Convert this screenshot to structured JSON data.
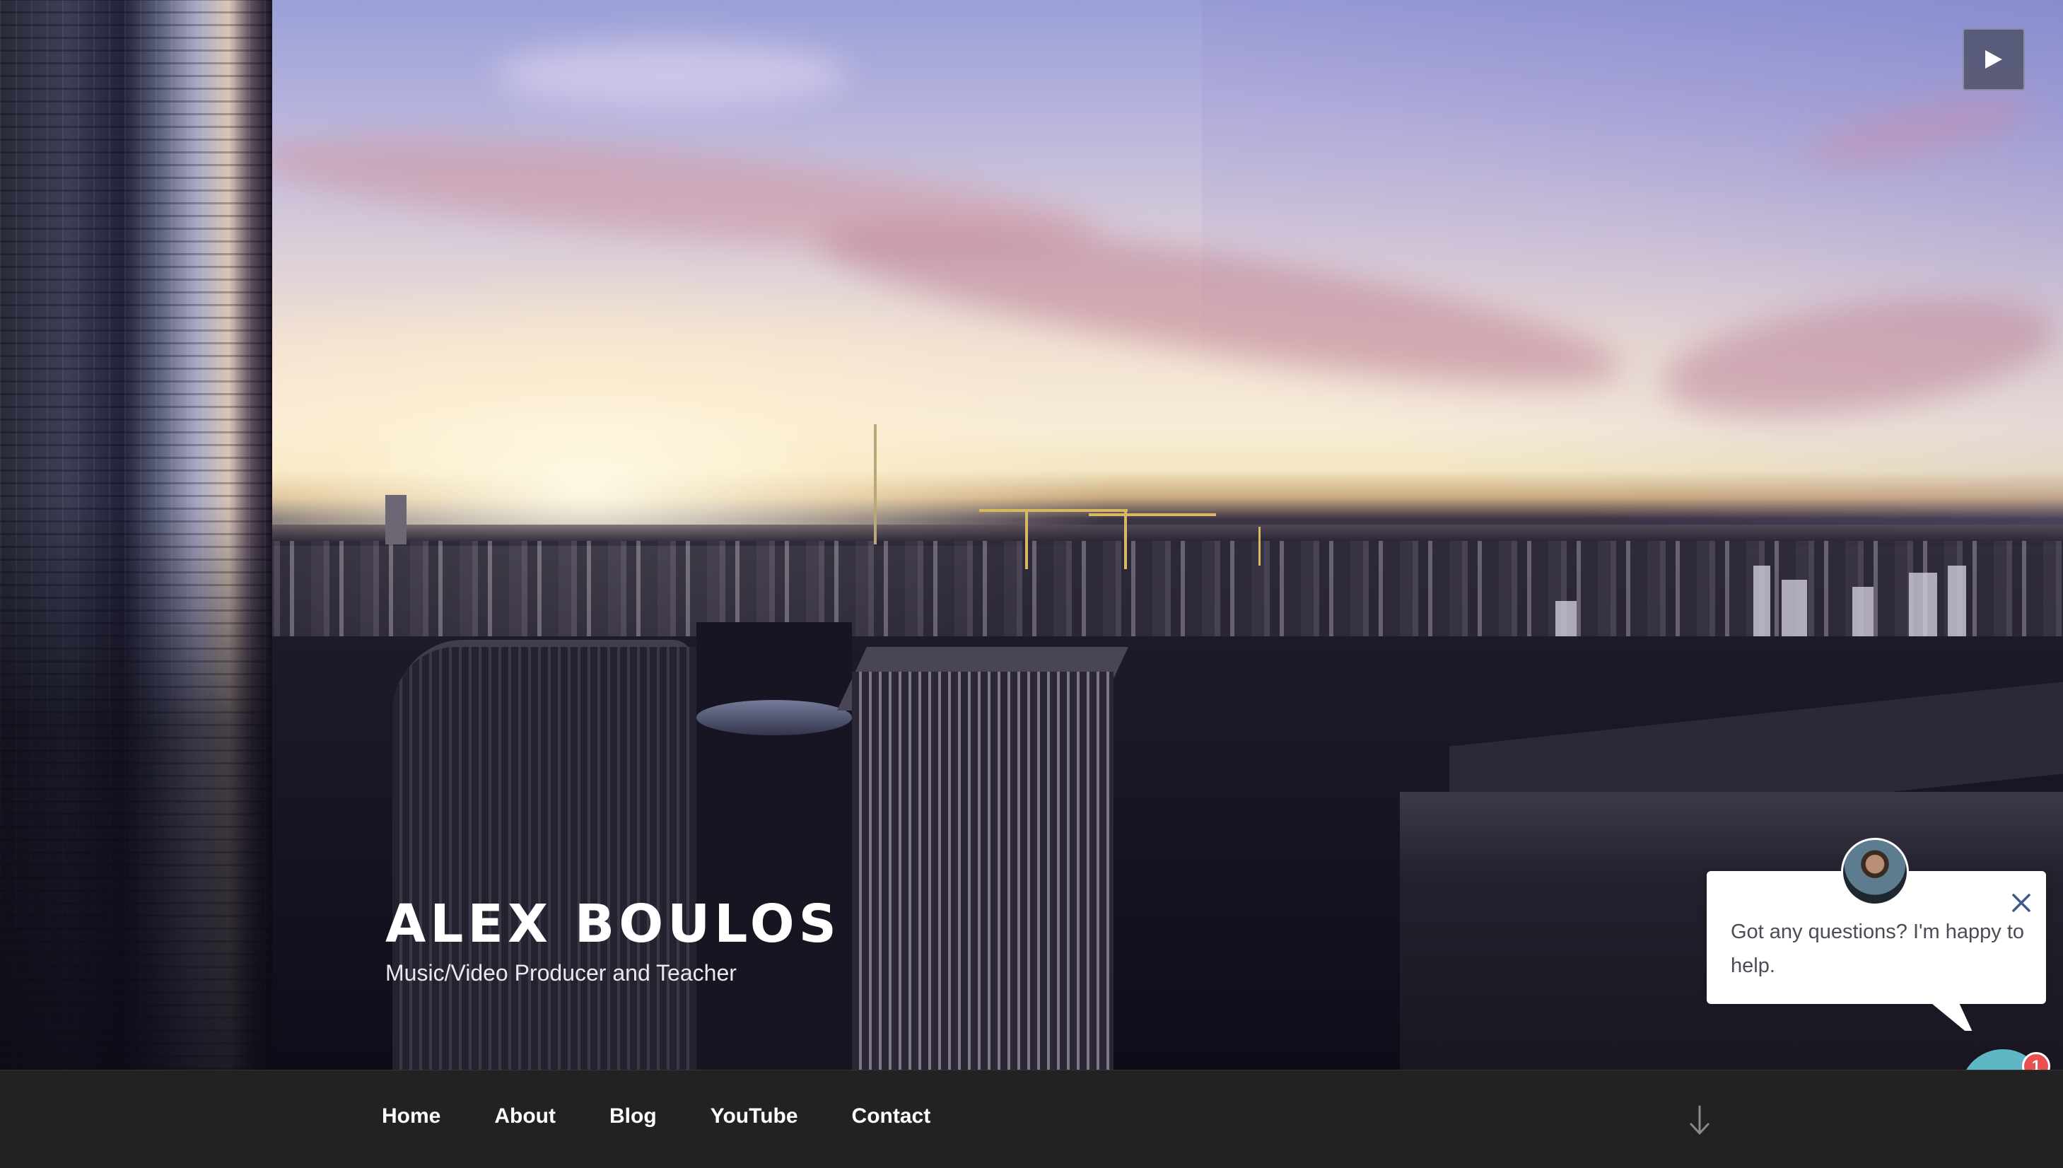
{
  "site": {
    "title": "ALEX BOULOS",
    "description": "Music/Video Producer and Teacher"
  },
  "header_video": {
    "play_icon": "play-icon"
  },
  "chat": {
    "message": "Got any questions? I'm happy to help.",
    "badge_count": "1",
    "close_icon": "close-icon",
    "launcher_icon": "chat-icon",
    "launcher_color": "#5fb7c6",
    "badge_color": "#e8514f"
  },
  "nav": {
    "items": [
      {
        "label": "Home"
      },
      {
        "label": "About"
      },
      {
        "label": "Blog"
      },
      {
        "label": "YouTube"
      },
      {
        "label": "Contact"
      }
    ],
    "scroll_icon": "arrow-down-icon",
    "background": "#222222"
  }
}
